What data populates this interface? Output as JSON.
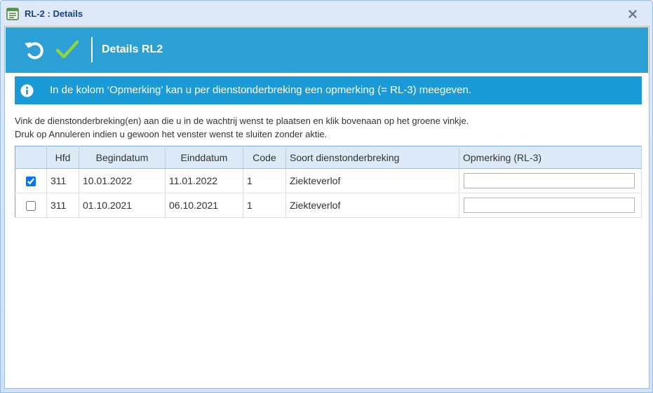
{
  "window": {
    "title": "RL-2 : Details",
    "title_icon": "window-list-icon",
    "close_icon": "close-icon"
  },
  "toolbar": {
    "undo_icon": "undo-icon",
    "confirm_icon": "checkmark-icon",
    "title": "Details RL2",
    "bg_color": "#2c9fd4",
    "confirm_color": "#8fd63a"
  },
  "info": {
    "icon": "info-icon",
    "text": "In de kolom ‘Opmerking’ kan u per dienstonderbreking een opmerking (= RL-3) meegeven."
  },
  "instructions": {
    "line1": "Vink de dienstonderbreking(en) aan die u in de wachtrij wenst te plaatsen en klik bovenaan op het groene vinkje.",
    "line2": "Druk op Annuleren indien u gewoon het venster wenst te sluiten zonder aktie."
  },
  "table": {
    "columns": [
      "",
      "Hfd",
      "Begindatum",
      "Einddatum",
      "Code",
      "Soort dienstonderbreking",
      "Opmerking (RL-3)"
    ],
    "rows": [
      {
        "checked": true,
        "hfd": "311",
        "begindatum": "10.01.2022",
        "einddatum": "11.01.2022",
        "code": "1",
        "soort": "Ziekteverlof",
        "opmerking": ""
      },
      {
        "checked": false,
        "hfd": "311",
        "begindatum": "01.10.2021",
        "einddatum": "06.10.2021",
        "code": "1",
        "soort": "Ziekteverlof",
        "opmerking": ""
      }
    ]
  }
}
